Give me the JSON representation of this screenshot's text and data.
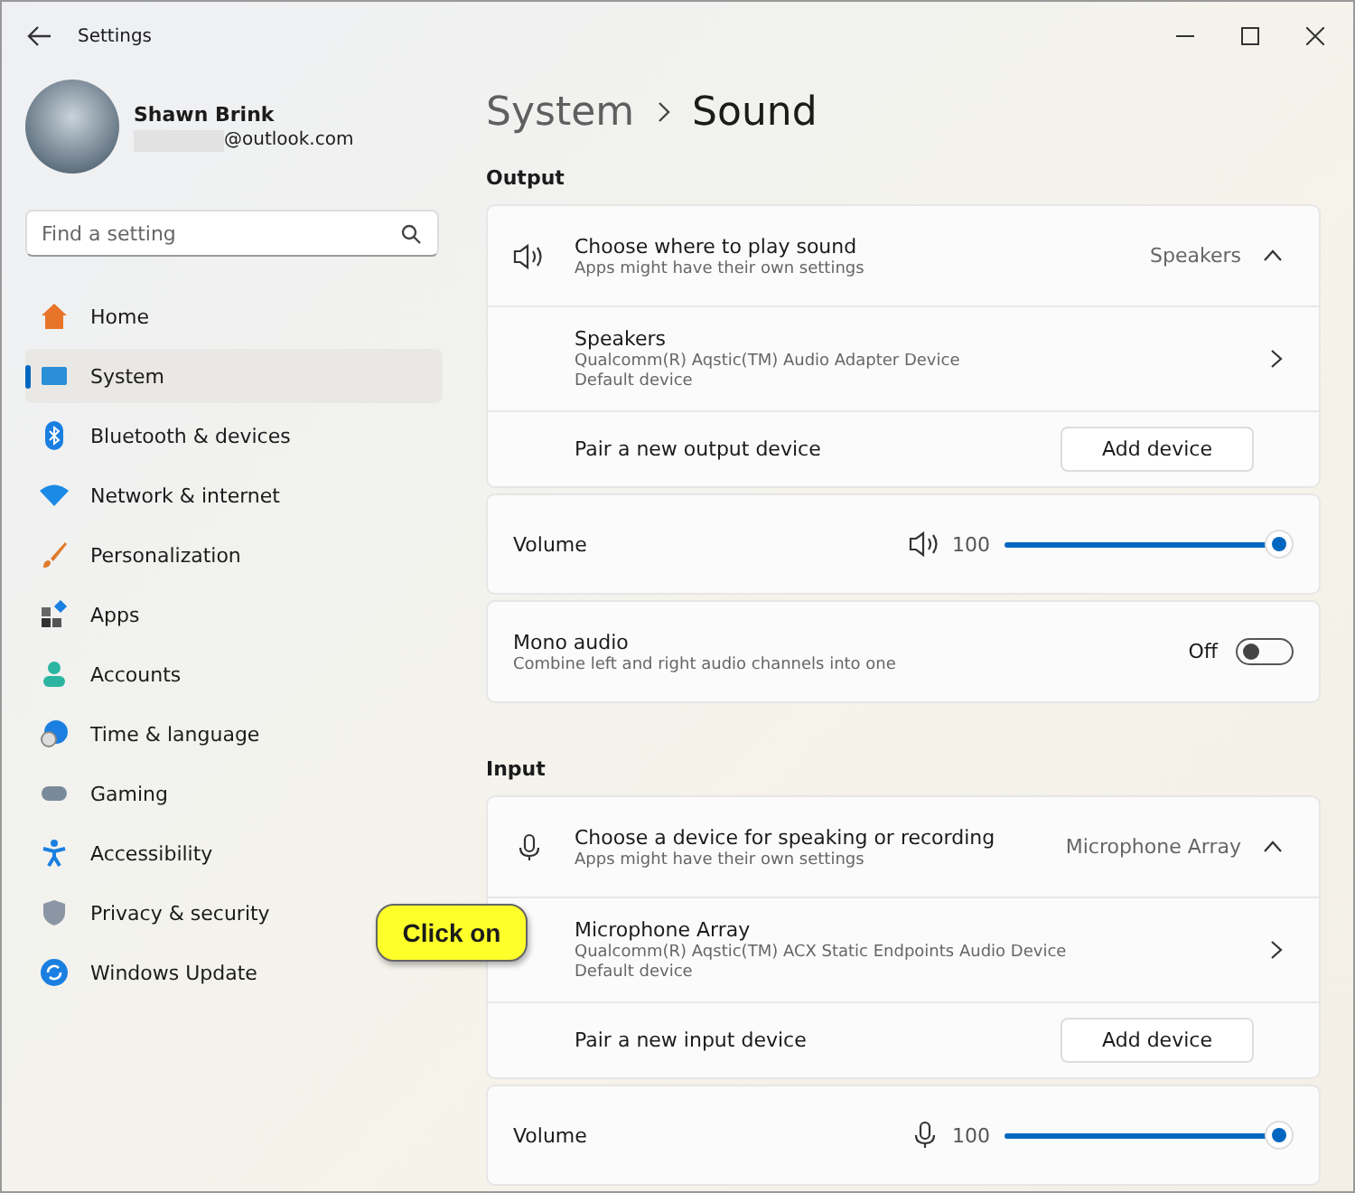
{
  "window": {
    "title": "Settings"
  },
  "user": {
    "name": "Shawn Brink",
    "email": "@outlook.com"
  },
  "search": {
    "placeholder": "Find a setting"
  },
  "nav": [
    {
      "label": "Home",
      "selected": false
    },
    {
      "label": "System",
      "selected": true
    },
    {
      "label": "Bluetooth & devices",
      "selected": false
    },
    {
      "label": "Network & internet",
      "selected": false
    },
    {
      "label": "Personalization",
      "selected": false
    },
    {
      "label": "Apps",
      "selected": false
    },
    {
      "label": "Accounts",
      "selected": false
    },
    {
      "label": "Time & language",
      "selected": false
    },
    {
      "label": "Gaming",
      "selected": false
    },
    {
      "label": "Accessibility",
      "selected": false
    },
    {
      "label": "Privacy & security",
      "selected": false
    },
    {
      "label": "Windows Update",
      "selected": false
    }
  ],
  "breadcrumb": [
    "System",
    "Sound"
  ],
  "sections": [
    {
      "kind": "output",
      "heading": "Output",
      "chooser": {
        "title": "Choose where to play sound",
        "subtitle": "Apps might have their own settings",
        "value": "Speakers",
        "expanded": true
      },
      "device": {
        "name": "Speakers",
        "description": "Qualcomm(R) Aqstic(TM) Audio Adapter Device",
        "status": "Default device"
      },
      "pair": {
        "label": "Pair a new output device",
        "button": "Add device"
      },
      "volume": {
        "label": "Volume",
        "reading": "100",
        "level": 1
      },
      "mono": {
        "title": "Mono audio",
        "subtitle": "Combine left and right audio channels into one",
        "state": "Off",
        "on": false
      }
    },
    {
      "kind": "input",
      "heading": "Input",
      "chooser": {
        "title": "Choose a device for speaking or recording",
        "subtitle": "Apps might have their own settings",
        "value": "Microphone Array",
        "expanded": true
      },
      "device": {
        "name": "Microphone Array",
        "description": "Qualcomm(R) Aqstic(TM) ACX Static Endpoints Audio Device",
        "status": "Default device"
      },
      "pair": {
        "label": "Pair a new input device",
        "button": "Add device"
      },
      "volume": {
        "label": "Volume",
        "reading": "100",
        "level": 1
      }
    }
  ],
  "callout": {
    "text": "Click on"
  }
}
